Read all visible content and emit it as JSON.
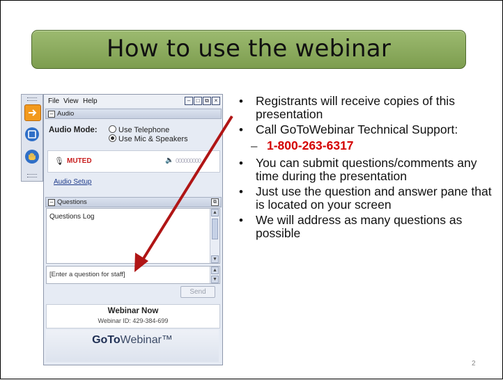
{
  "slide": {
    "title": "How to use the webinar",
    "page_number": "2"
  },
  "panel": {
    "menu": [
      "File",
      "View",
      "Help"
    ],
    "audio_section": "Audio",
    "audio_mode_label": "Audio Mode:",
    "radio_telephone": "Use Telephone",
    "radio_mic": "Use Mic & Speakers",
    "selected_mode": "Use Mic & Speakers",
    "muted_label": "MUTED",
    "level_bars": "000000000",
    "audio_setup_link": "Audio Setup",
    "questions_section": "Questions",
    "questions_log": "Questions Log",
    "question_placeholder": "[Enter a question for staff]",
    "send_button": "Send",
    "webinar_name": "Webinar Now",
    "webinar_id": "Webinar ID: 429-384-699",
    "brand_bold": "GoTo",
    "brand_rest": "Webinar™"
  },
  "bullets": [
    "Registrants will receive copies of this presentation",
    "Call GoToWebinar Technical Support:",
    "1-800-263-6317",
    "You can submit questions/comments any time during the presentation",
    "Just use the question and answer pane that is located on your screen",
    "We will address as many questions as possible"
  ],
  "colors": {
    "title_green": "#8aa85e",
    "phone_red": "#d40000",
    "arrow_red": "#b01515"
  }
}
